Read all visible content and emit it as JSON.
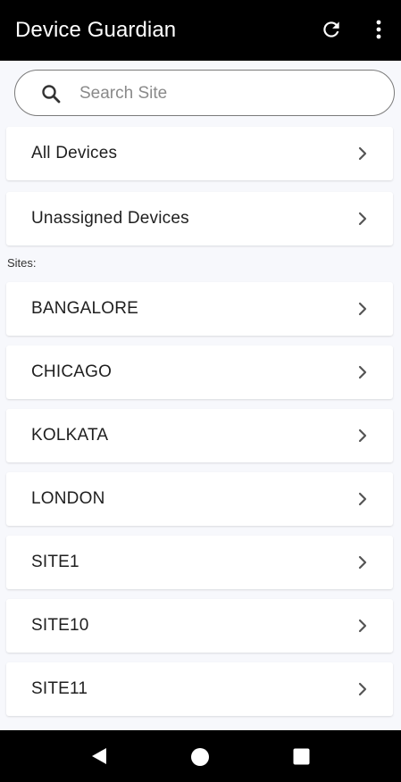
{
  "app_bar": {
    "title": "Device Guardian",
    "refresh_icon": "refresh-icon",
    "more_icon": "more-vert-icon",
    "background": "#000000"
  },
  "search": {
    "placeholder": "Search Site",
    "value": "",
    "icon": "search-icon"
  },
  "quick_links": [
    {
      "label": "All Devices"
    },
    {
      "label": "Unassigned Devices"
    }
  ],
  "sites_section": {
    "label": "Sites:",
    "items": [
      {
        "label": "BANGALORE"
      },
      {
        "label": "CHICAGO"
      },
      {
        "label": "KOLKATA"
      },
      {
        "label": "LONDON"
      },
      {
        "label": "SITE1"
      },
      {
        "label": "SITE10"
      },
      {
        "label": "SITE11"
      }
    ]
  },
  "nav_bar": {
    "back_icon": "nav-back-icon",
    "home_icon": "nav-home-icon",
    "recents_icon": "nav-recents-icon"
  }
}
